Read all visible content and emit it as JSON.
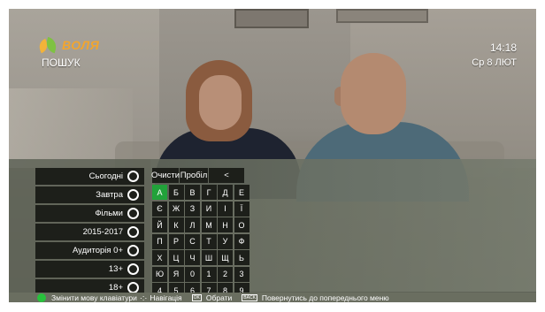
{
  "header": {
    "logo_text": "ВОЛЯ",
    "title": "ПОШУК",
    "time": "14:18",
    "date": "Ср 8 ЛЮТ"
  },
  "filters": [
    {
      "label": "Сьогодні",
      "icon": "radio-icon"
    },
    {
      "label": "Завтра",
      "icon": "radio-icon"
    },
    {
      "label": "Фільми",
      "icon": "radio-icon"
    },
    {
      "label": "2015-2017",
      "icon": "radio-icon"
    },
    {
      "label": "Аудиторія 0+",
      "icon": "radio-icon"
    },
    {
      "label": "13+",
      "icon": "radio-icon"
    },
    {
      "label": "18+",
      "icon": "radio-icon"
    }
  ],
  "keyboard": {
    "clear_label": "Очисти",
    "space_label": "Пробіл",
    "back_label": "<",
    "keys": [
      "А",
      "Б",
      "В",
      "Г",
      "Д",
      "Е",
      "Є",
      "Ж",
      "З",
      "И",
      "І",
      "Ї",
      "Й",
      "К",
      "Л",
      "М",
      "Н",
      "О",
      "П",
      "Р",
      "С",
      "Т",
      "У",
      "Ф",
      "Х",
      "Ц",
      "Ч",
      "Ш",
      "Щ",
      "Ь",
      "Ю",
      "Я",
      "0",
      "1",
      "2",
      "3",
      "4",
      "5",
      "6",
      "7",
      "8",
      "9"
    ],
    "selected_key": "А"
  },
  "bottom_bar": {
    "change_lang": "Змінити мову клавіатури",
    "navigation": "Навігація",
    "ok_icon": "OK",
    "select": "Обрати",
    "back_icon": "BACK",
    "back_menu": "Повернутись до попереднього меню"
  },
  "colors": {
    "accent_green": "#21a23a",
    "logo_orange": "#f2a52e"
  }
}
